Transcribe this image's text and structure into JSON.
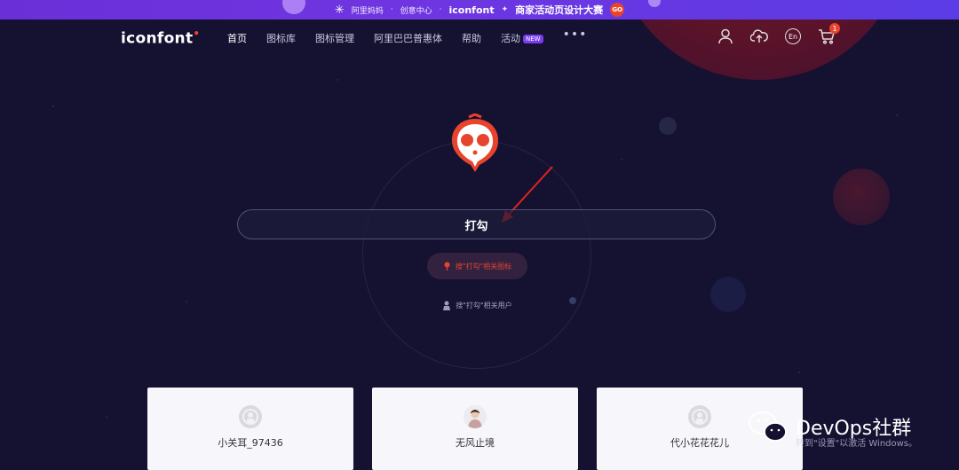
{
  "promo": {
    "brand": "阿里妈妈",
    "center": "创意中心",
    "logo": "iconfont",
    "headline": "商家活动页设计大赛",
    "go": "GO"
  },
  "nav": {
    "brand": "iconfont",
    "items": [
      {
        "label": "首页",
        "active": true
      },
      {
        "label": "图标库"
      },
      {
        "label": "图标管理"
      },
      {
        "label": "阿里巴巴普惠体"
      },
      {
        "label": "帮助"
      },
      {
        "label": "活动",
        "badge": "NEW"
      }
    ],
    "more": "•••",
    "language": "En",
    "cart_count": "1"
  },
  "search": {
    "query": "打勾"
  },
  "suggestions": {
    "icons_label": "搜\"打勾\"相关图标",
    "users_label": "搜\"打勾\"相关用户"
  },
  "users": [
    {
      "name": "小关耳_97436"
    },
    {
      "name": "无风止境"
    },
    {
      "name": "代小花花花儿"
    }
  ],
  "watermark": {
    "text": "DevOps社群",
    "hint": "转到\"设置\"以激活 Windows。"
  },
  "colors": {
    "accent": "#e8432d",
    "background": "#141131",
    "banner": "#6b2fd8"
  }
}
